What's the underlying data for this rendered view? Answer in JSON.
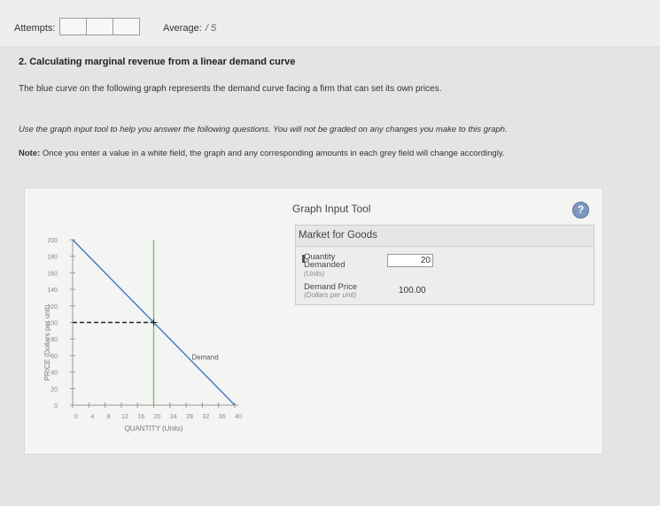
{
  "header": {
    "attempts_label": "Attempts:",
    "attempt_boxes": 3,
    "average_label": "Average:",
    "average_value": "/ 5"
  },
  "question": {
    "title": "2. Calculating marginal revenue from a linear demand curve",
    "intro": "The blue curve on the following graph represents the demand curve facing a firm that can set its own prices.",
    "instruction": "Use the graph input tool to help you answer the following questions. You will not be graded on any changes you make to this graph.",
    "note_label": "Note:",
    "note_text": " Once you enter a value in a white field, the graph and any corresponding amounts in each grey field will change accordingly."
  },
  "tool": {
    "title": "Graph Input Tool",
    "help_symbol": "?",
    "market": "Market for Goods",
    "quantity_label_line1": "Quantity",
    "quantity_label_line2": "Demanded",
    "quantity_units": "(Units)",
    "quantity_value": "20",
    "price_label": "Demand Price",
    "price_units": "(Dollars per unit)",
    "price_value": "100.00"
  },
  "chart_data": {
    "type": "line",
    "xlabel": "QUANTITY (Units)",
    "ylabel": "PRICE (Dollars per unit)",
    "xlim": [
      0,
      40
    ],
    "ylim": [
      0,
      200
    ],
    "xticks": [
      0,
      4,
      8,
      12,
      16,
      20,
      24,
      28,
      32,
      36,
      40
    ],
    "yticks": [
      0,
      20,
      40,
      60,
      80,
      100,
      120,
      140,
      160,
      180,
      200
    ],
    "series": [
      {
        "name": "Demand",
        "color": "#3a79c4",
        "x": [
          0,
          40
        ],
        "y": [
          200,
          0
        ]
      }
    ],
    "vertical_line": {
      "x": 20,
      "color": "#7fc47a"
    },
    "selected_point": {
      "x": 20,
      "y": 100
    },
    "grid": false
  }
}
